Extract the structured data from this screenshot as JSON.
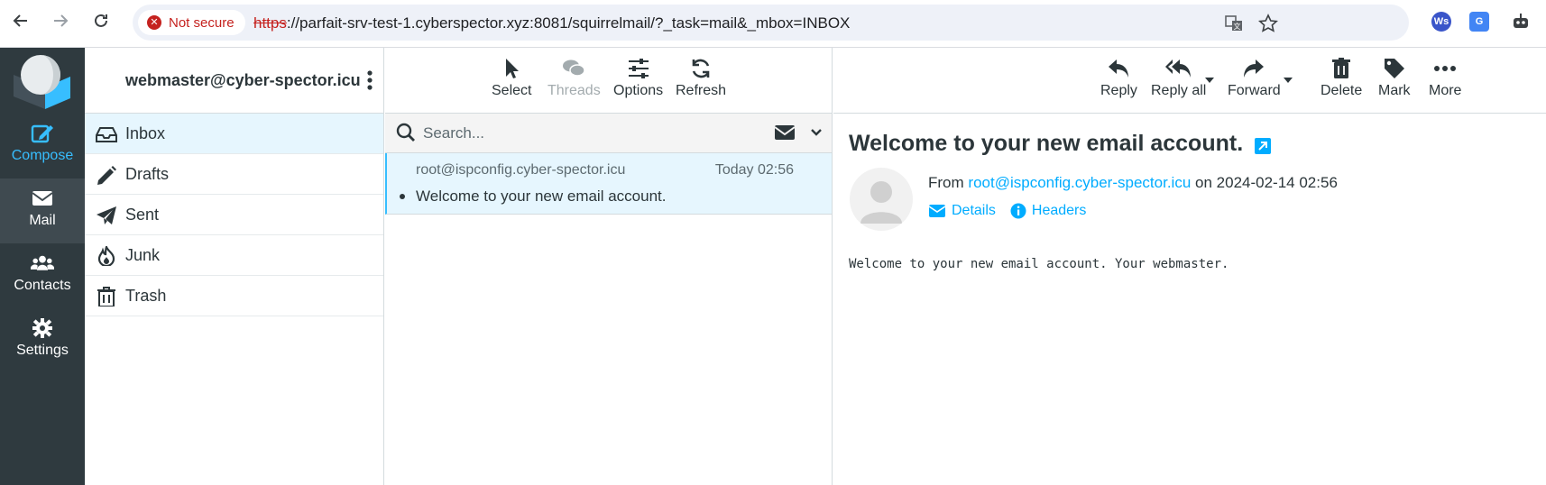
{
  "browser": {
    "security_label": "Not secure",
    "url_scheme": "https",
    "url_rest": "://parfait-srv-test-1.cyberspector.xyz:8081/squirrelmail/?_task=mail&_mbox=INBOX"
  },
  "nav": {
    "compose": "Compose",
    "mail": "Mail",
    "contacts": "Contacts",
    "settings": "Settings"
  },
  "account": {
    "email": "webmaster@cyber-spector.icu"
  },
  "folders": [
    {
      "label": "Inbox",
      "icon": "inbox-icon",
      "active": true
    },
    {
      "label": "Drafts",
      "icon": "pencil-icon"
    },
    {
      "label": "Sent",
      "icon": "paper-plane-icon"
    },
    {
      "label": "Junk",
      "icon": "fire-icon"
    },
    {
      "label": "Trash",
      "icon": "trash-icon"
    }
  ],
  "list_toolbar": {
    "select": "Select",
    "threads": "Threads",
    "options": "Options",
    "refresh": "Refresh"
  },
  "search": {
    "placeholder": "Search..."
  },
  "messages": [
    {
      "from": "root@ispconfig.cyber-spector.icu",
      "date": "Today 02:56",
      "subject": "Welcome to your new email account."
    }
  ],
  "reader_toolbar": {
    "reply": "Reply",
    "reply_all": "Reply all",
    "forward": "Forward",
    "delete": "Delete",
    "mark": "Mark",
    "more": "More"
  },
  "message": {
    "subject": "Welcome to your new email account.",
    "from_prefix": "From",
    "from_address": "root@ispconfig.cyber-spector.icu",
    "on_word": "on",
    "date": "2024-02-14 02:56",
    "details_label": "Details",
    "headers_label": "Headers",
    "body": "Welcome to your new email account. Your webmaster."
  },
  "colors": {
    "accent": "#37beff",
    "nav_bg": "#2f3a3f",
    "selected_bg": "#e6f6fe",
    "link": "#00acff"
  }
}
